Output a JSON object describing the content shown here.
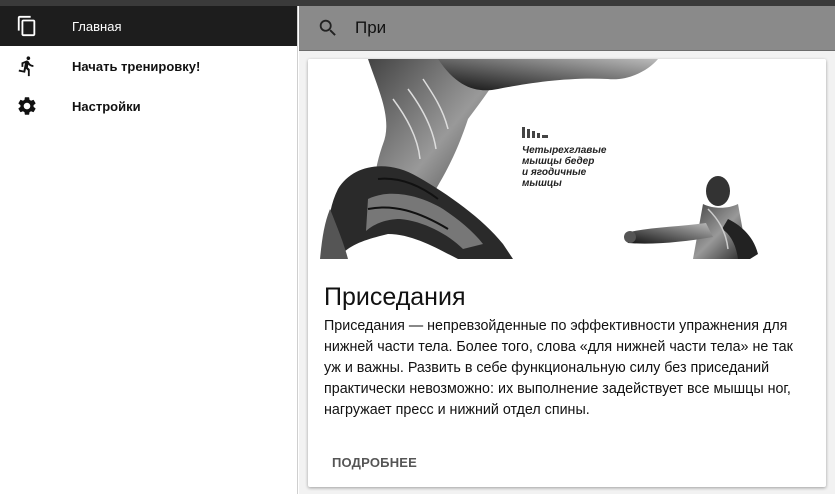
{
  "sidebar": {
    "items": [
      {
        "label": "Главная",
        "icon": "copy-icon",
        "active": true
      },
      {
        "label": "Начать тренировку!",
        "icon": "run-icon",
        "active": false
      },
      {
        "label": "Настройки",
        "icon": "gear-icon",
        "active": false
      }
    ]
  },
  "search": {
    "value": "При",
    "icon": "search-icon"
  },
  "card": {
    "image_caption": [
      "Четырехглавые",
      "мышцы бедер",
      "и ягодичные",
      "мышцы"
    ],
    "title": "Приседания",
    "text": "Приседания — непревзойденные по эффективности упражнения для нижней части тела. Более того, слова «для нижней части тела» не так уж и важны. Развить в себе функциональную силу без приседаний практически невозможно: их выполнение задействует все мышцы ног, нагружает пресс и нижний отдел спины.",
    "action_label": "ПОДРОБНЕЕ"
  },
  "colors": {
    "active_nav": "#1d1d1d",
    "search_bar": "#8a8a8a",
    "background": "#f2f2f2"
  }
}
